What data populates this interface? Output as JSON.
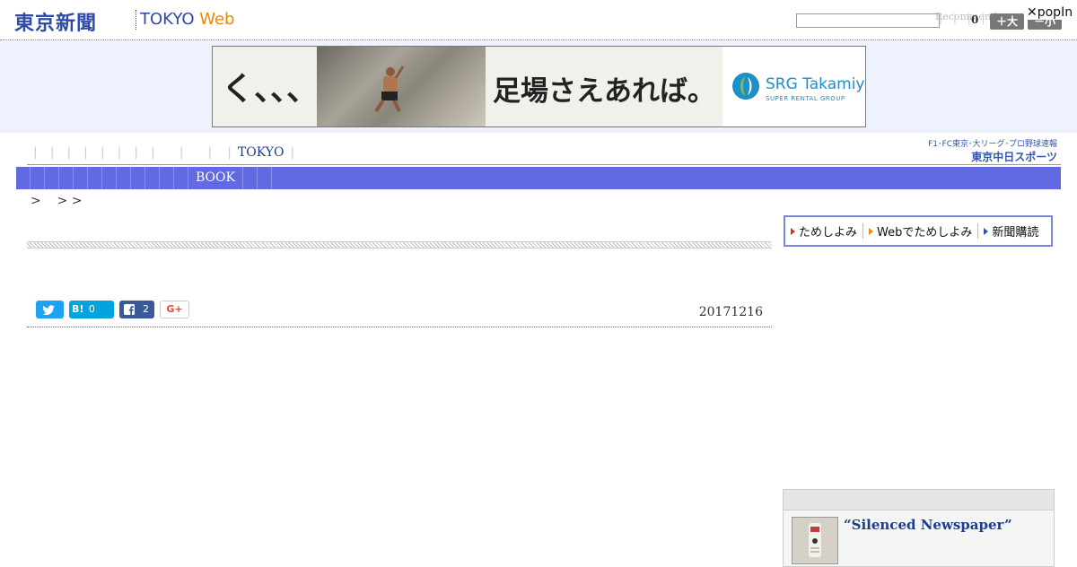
{
  "header": {
    "logo_jp": "東京新聞",
    "logo_tokyo": "TOKYO ",
    "logo_web": "Web",
    "search_value": "",
    "recommend_label": "Recommend",
    "pipes": "| | | |",
    "count": "0",
    "font_large_label": "＋大",
    "font_small_label": "－小",
    "popin_label": "✕popIn"
  },
  "ad": {
    "hook_text": "く、、、",
    "headline": "足場さえあれば。",
    "brand_name": "SRG Takamiya",
    "brand_sub": "SUPER RENTAL GROUP"
  },
  "nav": {
    "top_items": [
      "",
      "",
      "",
      "",
      "",
      "",
      "",
      "",
      "",
      "",
      "",
      "",
      "",
      "TOKYO"
    ],
    "chunichi_tag": "F1･FC東京･大リーグ･プロ野球速報",
    "chunichi_name": "東京中日スポーツ",
    "bar_label": "BOOK"
  },
  "breadcrumb": ">    > >",
  "article": {
    "date": "20171216",
    "share": {
      "twitter_icon": "twitter-icon",
      "hatena_label": "B!",
      "hatena_count": "0",
      "facebook_count": "2",
      "google_label": "G+"
    }
  },
  "sidebar": {
    "subscribe": [
      {
        "label": "ためしよみ",
        "color": "#d9302b"
      },
      {
        "label": "Webでためしよみ",
        "color": "#f08a1c"
      },
      {
        "label": "新聞購読",
        "color": "#3356a6"
      }
    ],
    "related_title": "“Silenced Newspaper”"
  },
  "colors": {
    "brand_blue": "#2d4aa8",
    "web_orange": "#e88a0e",
    "nav_bar": "#626ae3",
    "ad_band": "#eef2fc"
  }
}
